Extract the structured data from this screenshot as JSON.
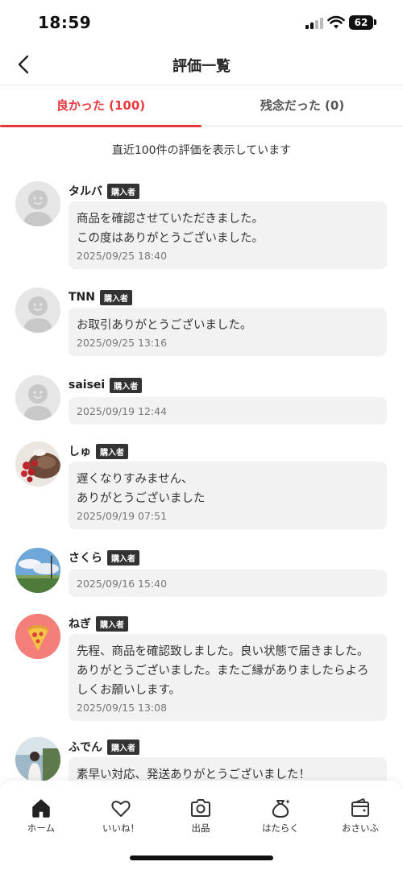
{
  "status_bar": {
    "time": "18:59",
    "battery": "62"
  },
  "header": {
    "title": "評価一覧"
  },
  "tabs": [
    {
      "label": "良かった (100)",
      "active": true
    },
    {
      "label": "残念だった (0)",
      "active": false
    }
  ],
  "notice": "直近100件の評価を表示しています",
  "reviews": [
    {
      "name": "タルバ",
      "badge": "購入者",
      "comment": "商品を確認させていただきました。\nこの度はありがとうございました。",
      "date": "2025/09/25 18:40",
      "avatar": "default-avatar"
    },
    {
      "name": "TNN",
      "badge": "購入者",
      "comment": "お取引ありがとうございました。",
      "date": "2025/09/25 13:16",
      "avatar": "default-avatar"
    },
    {
      "name": "saisei",
      "badge": "購入者",
      "comment": "",
      "date": "2025/09/19 12:44",
      "avatar": "default-avatar"
    },
    {
      "name": "しゅ",
      "badge": "購入者",
      "comment": "遅くなりすみません、\nありがとうございました",
      "date": "2025/09/19 07:51",
      "avatar": "food-photo-avatar"
    },
    {
      "name": "さくら",
      "badge": "購入者",
      "comment": "",
      "date": "2025/09/16 15:40",
      "avatar": "landscape-photo-avatar"
    },
    {
      "name": "ねぎ",
      "badge": "購入者",
      "comment": "先程、商品を確認致しました。良い状態で届きました。ありがとうございました。またご縁がありましたらよろしくお願いします。",
      "date": "2025/09/15 13:08",
      "avatar": "pizza-avatar"
    },
    {
      "name": "ふでん",
      "badge": "購入者",
      "comment": "素早い対応、発送ありがとうございました！",
      "date": "",
      "avatar": "person-photo-avatar"
    }
  ],
  "bottom_nav": [
    {
      "label": "ホーム",
      "icon": "home-icon"
    },
    {
      "label": "いいね！",
      "icon": "heart-icon"
    },
    {
      "label": "出品",
      "icon": "camera-icon"
    },
    {
      "label": "はたらく",
      "icon": "money-bag-icon"
    },
    {
      "label": "おさいふ",
      "icon": "wallet-icon"
    }
  ],
  "colors": {
    "accent": "#e8383d",
    "badge": "#333333",
    "bubble": "#f2f2f2"
  }
}
